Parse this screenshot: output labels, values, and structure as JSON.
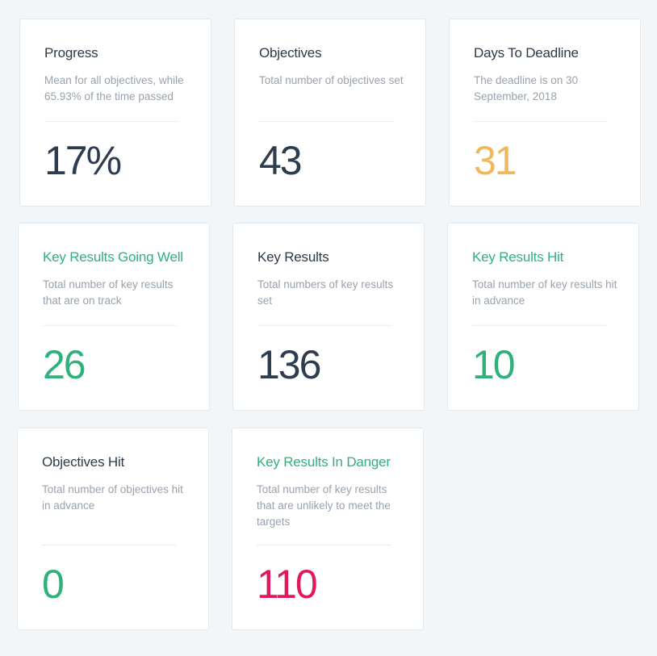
{
  "cards": [
    {
      "title": "Progress",
      "description": "Mean for all objectives, while 65.93% of the time passed",
      "value": "17%",
      "title_color": "#2b3a4a",
      "value_color": "#2d3c4e"
    },
    {
      "title": "Objectives",
      "description": "Total number of objectives set",
      "value": "43",
      "title_color": "#2b3a4a",
      "value_color": "#2d3c4e"
    },
    {
      "title": "Days To Deadline",
      "description": "The deadline is on 30 September, 2018",
      "value": "31",
      "title_color": "#2b3a4a",
      "value_color": "#f0b85a"
    },
    {
      "title": "Key Results Going Well",
      "description": "Total number of key results that are on track",
      "value": "26",
      "title_color": "#2fb17c",
      "value_color": "#2fb17c"
    },
    {
      "title": "Key Results",
      "description": "Total numbers of key results set",
      "value": "136",
      "title_color": "#2b3a4a",
      "value_color": "#2d3c4e"
    },
    {
      "title": "Key Results Hit",
      "description": "Total number of key results hit in advance",
      "value": "10",
      "title_color": "#2fb17c",
      "value_color": "#2fb17c"
    },
    {
      "title": "Objectives Hit",
      "description": "Total number of objectives hit in advance",
      "value": "0",
      "title_color": "#2b3a4a",
      "value_color": "#2fb17c"
    },
    {
      "title": "Key Results In Danger",
      "description": "Total number of key results that are unlikely to meet the targets",
      "value": "110",
      "title_color": "#2fb17c",
      "value_color": "#e0195a"
    }
  ]
}
